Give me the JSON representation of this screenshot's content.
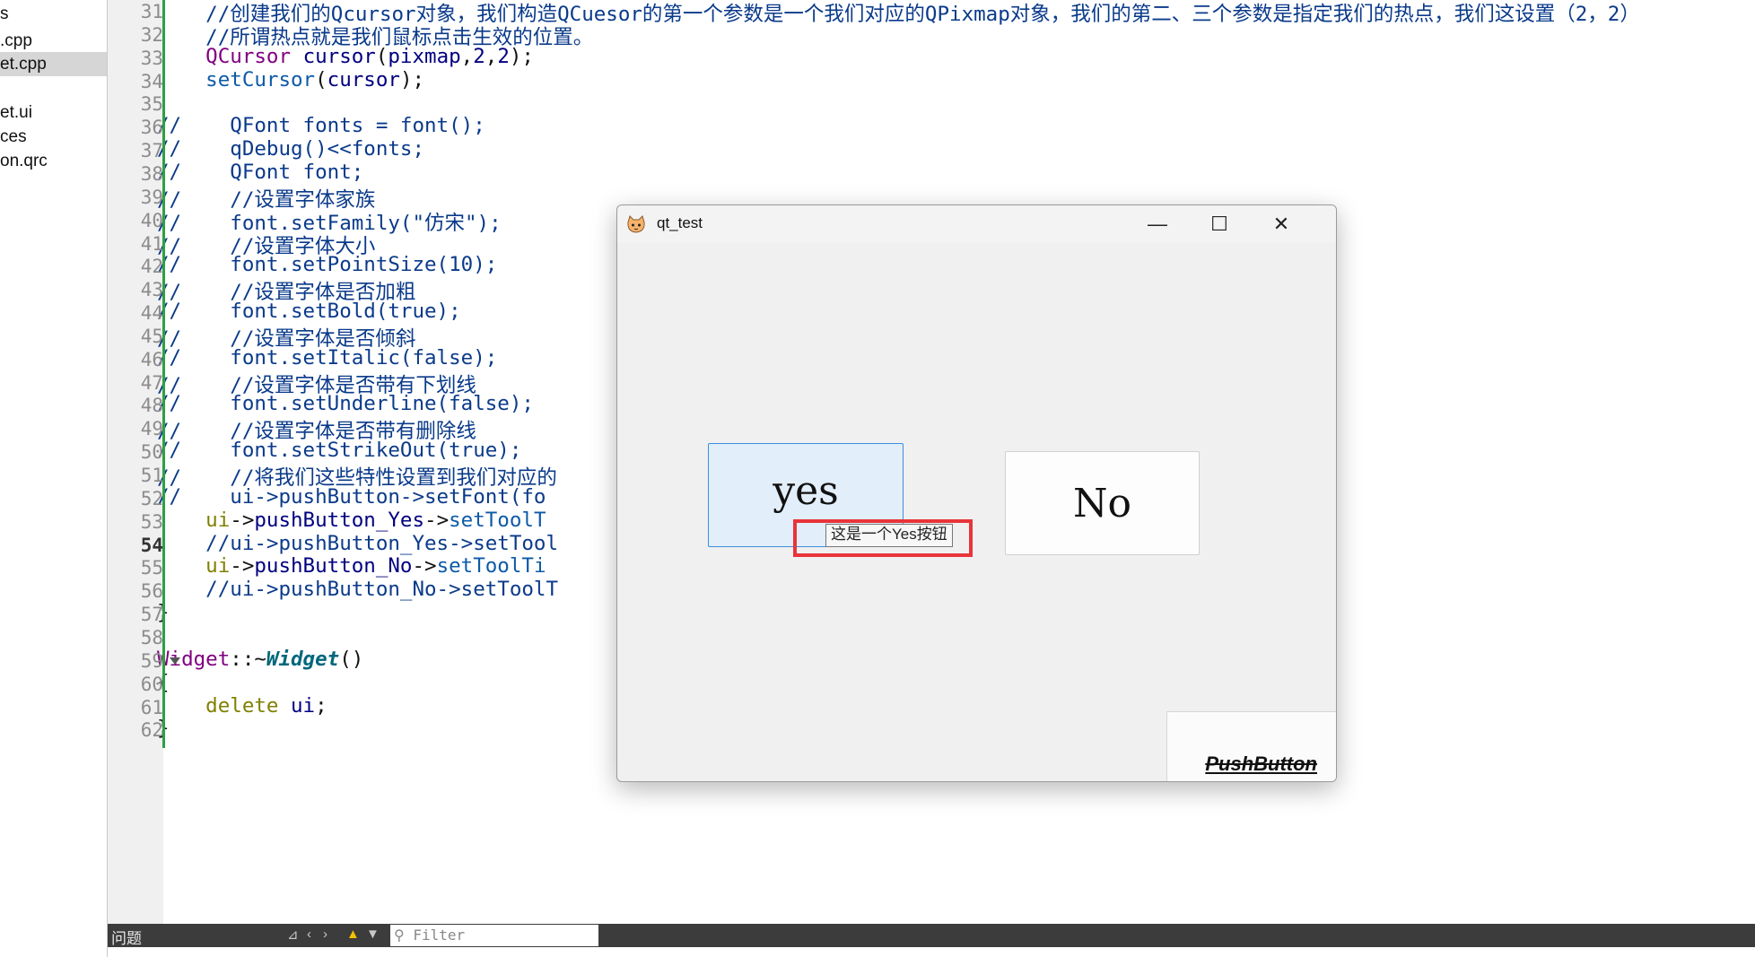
{
  "file_tree": {
    "items": [
      {
        "label": "s",
        "selected": false
      },
      {
        "label": ".cpp",
        "selected": false
      },
      {
        "label": "et.cpp",
        "selected": true
      },
      {
        "label": "et.ui",
        "selected": false
      },
      {
        "label": "ces",
        "selected": false
      },
      {
        "label": "on.qrc",
        "selected": false
      }
    ]
  },
  "editor": {
    "lines": [
      {
        "no": "31",
        "parts": [
          [
            "c-comment",
            "    //创建我们的Qcursor对象，我们构造QCuesor的第一个参数是一个我们对应的QPixmap对象，我们的第二、三个参数是指定我们的热点，我们这设置（2，2）"
          ]
        ]
      },
      {
        "no": "32",
        "parts": [
          [
            "c-comment",
            "    //所谓热点就是我们鼠标点击生效的位置。"
          ]
        ]
      },
      {
        "no": "33",
        "parts": [
          [
            "c-type",
            "    QCursor "
          ],
          [
            "c-var",
            "cursor"
          ],
          [
            "",
            "("
          ],
          [
            "c-var",
            "pixmap"
          ],
          [
            "",
            ","
          ],
          [
            "c-num",
            "2"
          ],
          [
            "",
            ","
          ],
          [
            "c-num",
            "2"
          ],
          [
            "",
            ");"
          ]
        ]
      },
      {
        "no": "34",
        "parts": [
          [
            "c-fn",
            "    setCursor"
          ],
          [
            "",
            "("
          ],
          [
            "c-var",
            "cursor"
          ],
          [
            "",
            ");"
          ]
        ]
      },
      {
        "no": "35",
        "parts": []
      },
      {
        "no": "36",
        "parts": [
          [
            "c-comment",
            "//    QFont fonts = font();"
          ]
        ]
      },
      {
        "no": "37",
        "parts": [
          [
            "c-comment",
            "//    qDebug()<<fonts;"
          ]
        ]
      },
      {
        "no": "38",
        "parts": [
          [
            "c-comment",
            "//    QFont font;"
          ]
        ]
      },
      {
        "no": "39",
        "parts": [
          [
            "c-comment",
            "//    //设置字体家族"
          ]
        ]
      },
      {
        "no": "40",
        "parts": [
          [
            "c-comment",
            "//    font.setFamily(\"仿宋\");"
          ]
        ]
      },
      {
        "no": "41",
        "parts": [
          [
            "c-comment",
            "//    //设置字体大小"
          ]
        ]
      },
      {
        "no": "42",
        "parts": [
          [
            "c-comment",
            "//    font.setPointSize(10);"
          ]
        ]
      },
      {
        "no": "43",
        "parts": [
          [
            "c-comment",
            "//    //设置字体是否加粗"
          ]
        ]
      },
      {
        "no": "44",
        "parts": [
          [
            "c-comment",
            "//    font.setBold(true);"
          ]
        ]
      },
      {
        "no": "45",
        "parts": [
          [
            "c-comment",
            "//    //设置字体是否倾斜"
          ]
        ]
      },
      {
        "no": "46",
        "parts": [
          [
            "c-comment",
            "//    font.setItalic(false);"
          ]
        ]
      },
      {
        "no": "47",
        "parts": [
          [
            "c-comment",
            "//    //设置字体是否带有下划线"
          ]
        ]
      },
      {
        "no": "48",
        "parts": [
          [
            "c-comment",
            "//    font.setUnderline(false);"
          ]
        ]
      },
      {
        "no": "49",
        "parts": [
          [
            "c-comment",
            "//    //设置字体是否带有删除线"
          ]
        ]
      },
      {
        "no": "50",
        "parts": [
          [
            "c-comment",
            "//    font.setStrikeOut(true);"
          ]
        ]
      },
      {
        "no": "51",
        "parts": [
          [
            "c-comment",
            "//    //将我们这些特性设置到我们对应的"
          ]
        ]
      },
      {
        "no": "52",
        "parts": [
          [
            "c-comment",
            "//    ui->pushButton->setFont(fo"
          ]
        ]
      },
      {
        "no": "53",
        "parts": [
          [
            "c-kw",
            "    ui"
          ],
          [
            "",
            "->"
          ],
          [
            "c-var",
            "pushButton_Yes"
          ],
          [
            "",
            "->"
          ],
          [
            "c-fn",
            "setToolT"
          ]
        ]
      },
      {
        "no": "54",
        "parts": [
          [
            "c-comment",
            "    //ui->pushButton_Yes->setTool"
          ]
        ]
      },
      {
        "no": "55",
        "parts": [
          [
            "c-kw",
            "    ui"
          ],
          [
            "",
            "->"
          ],
          [
            "c-var",
            "pushButton_No"
          ],
          [
            "",
            "->"
          ],
          [
            "c-fn",
            "setToolTi"
          ]
        ]
      },
      {
        "no": "56",
        "parts": [
          [
            "c-comment",
            "    //ui->pushButton_No->setToolT"
          ]
        ]
      },
      {
        "no": "57",
        "parts": [
          [
            "",
            "}"
          ]
        ]
      },
      {
        "no": "58",
        "parts": []
      },
      {
        "no": "59",
        "parts": [
          [
            "c-class",
            "Widget"
          ],
          [
            "",
            "::~"
          ],
          [
            "c-dtor",
            "Widget"
          ],
          [
            "",
            "()"
          ]
        ]
      },
      {
        "no": "60",
        "parts": [
          [
            "",
            "{"
          ]
        ]
      },
      {
        "no": "61",
        "parts": [
          [
            "c-kw",
            "    delete "
          ],
          [
            "c-var",
            "ui"
          ],
          [
            "",
            ";"
          ]
        ]
      },
      {
        "no": "62",
        "parts": [
          [
            "",
            "}"
          ]
        ]
      }
    ],
    "current_line": "54",
    "fold_line": "59"
  },
  "issues_bar": {
    "title": "问题",
    "filter_placeholder": "Filter",
    "icons": [
      "build-icon",
      "prev-arrow-icon",
      "next-arrow-icon",
      "warning-icon",
      "filter-icon"
    ]
  },
  "qt_window": {
    "title": "qt_test",
    "controls": {
      "minimize": "—",
      "maximize": "☐",
      "close": "✕"
    },
    "yes_button": "yes",
    "no_button": "No",
    "tooltip": "这是一个Yes按钮",
    "push_button": "PushButton",
    "highlight_color": "#e8343a",
    "focus_color": "#3a8ee0"
  }
}
